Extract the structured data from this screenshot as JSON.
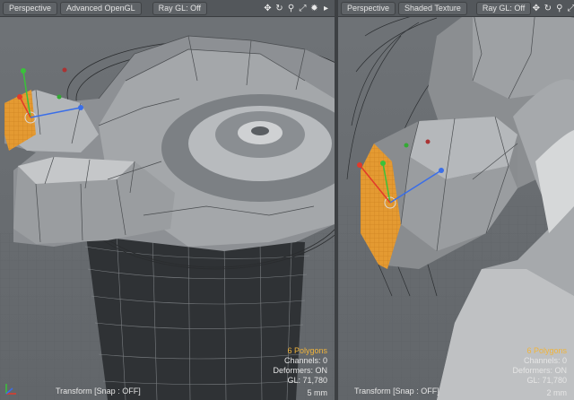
{
  "left_viewport": {
    "toolbar": {
      "view_mode": "Perspective",
      "shading": "Advanced OpenGL",
      "raygl": "Ray GL: Off"
    },
    "hud": {
      "polygons": "6 Polygons",
      "channels": "Channels: 0",
      "deformers": "Deformers: ON",
      "gl": "GL: 71,780"
    },
    "status": "Transform  [Snap : OFF]",
    "scale": "5 mm"
  },
  "right_viewport": {
    "toolbar": {
      "view_mode": "Perspective",
      "shading": "Shaded Texture",
      "raygl": "Ray GL: Off"
    },
    "hud": {
      "polygons": "6 Polygons",
      "channels": "Channels: 0",
      "deformers": "Deformers: ON",
      "gl": "GL: 71,780"
    },
    "status": "Transform  [Snap : OFF]",
    "scale": "2 mm"
  },
  "toolbar_icons": [
    "move-icon",
    "rotate-icon",
    "zoom-icon",
    "settings-icon",
    "expand-icon"
  ],
  "colors": {
    "selection": "#e8a43a",
    "x_axis": "#e23a2a",
    "y_axis": "#3ac23a",
    "z_axis": "#3a6ee8",
    "hud_highlight": "#f0b43c"
  }
}
